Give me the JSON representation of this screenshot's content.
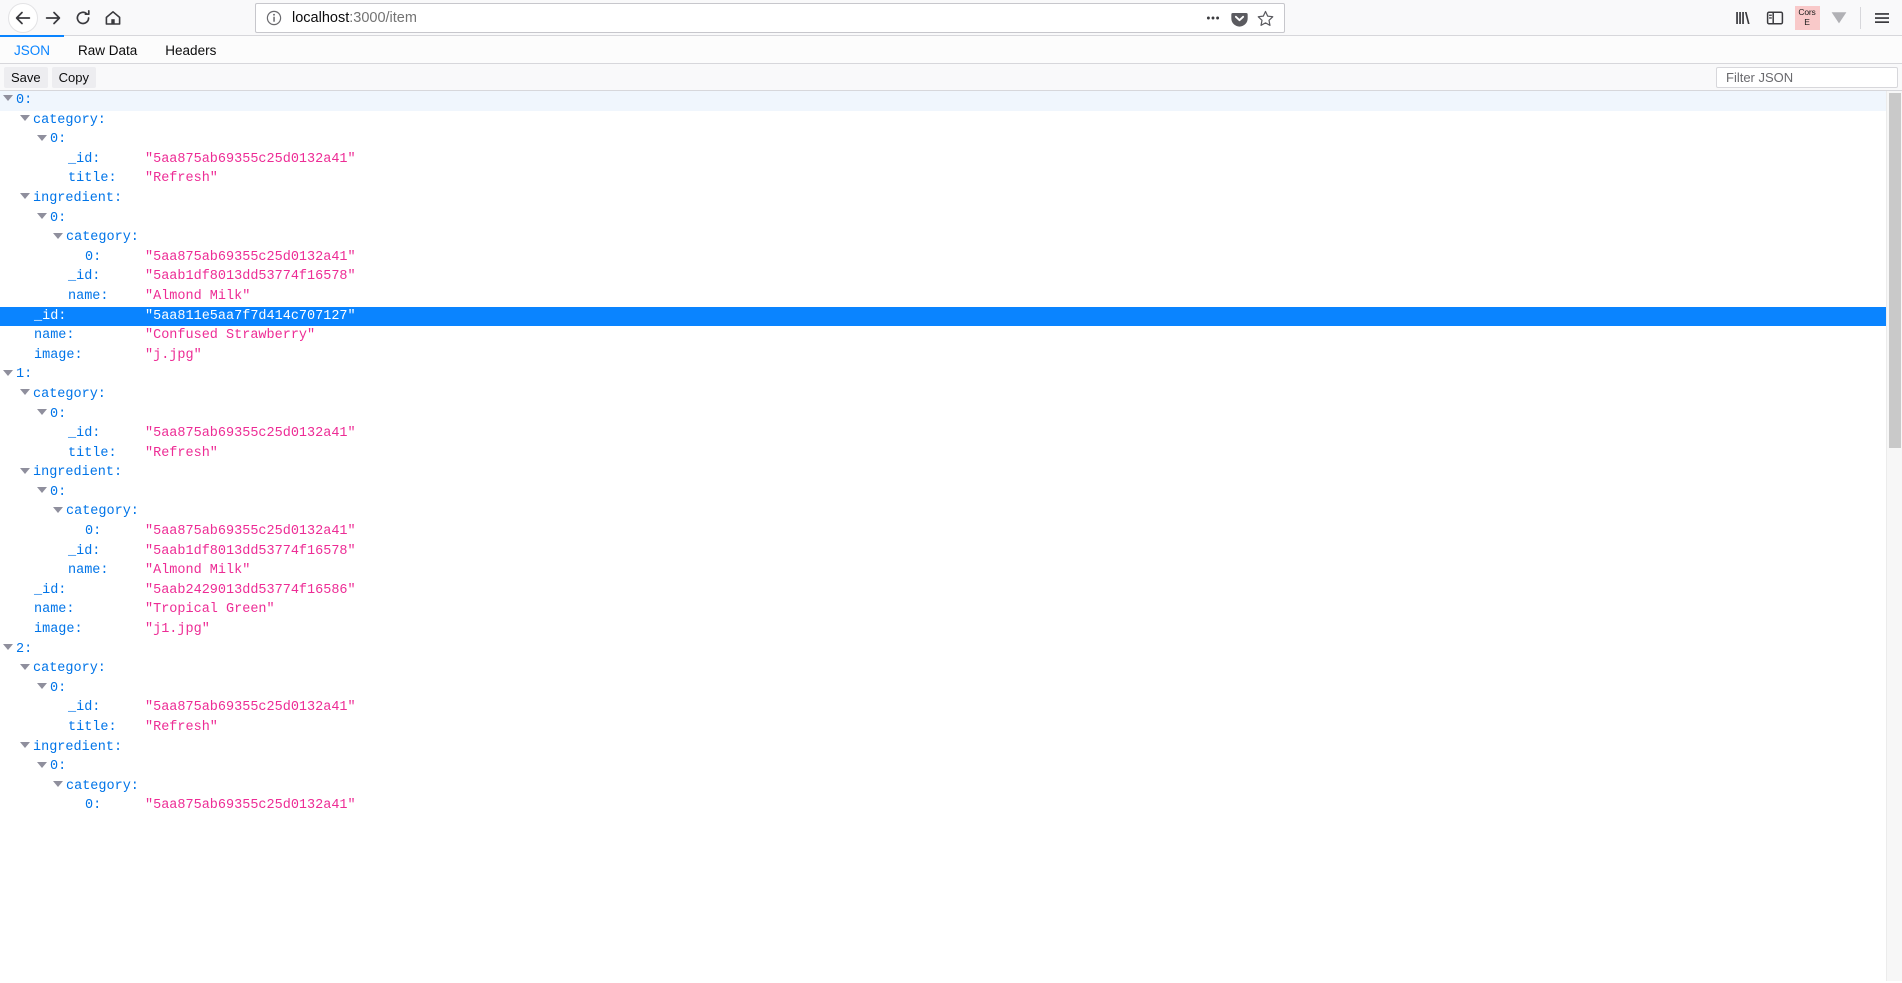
{
  "browser": {
    "nav": {
      "back": "back-arrow",
      "forward": "forward-arrow",
      "reload": "reload-arrow",
      "home": "home-house"
    },
    "urlbar": {
      "identity_icon": "info-circle-icon",
      "host": "localhost",
      "path": ":3000/item",
      "full_url": "localhost:3000/item",
      "page_actions_icon": "ellipsis-icon",
      "pocket_icon": "pocket-icon",
      "bookmark_icon": "star-icon"
    },
    "toolbar_right": {
      "library_icon": "library-icon",
      "sidebar_icon": "sidebar-icon",
      "extension_badge": "Cors E",
      "extension_badge_line1": "Cors",
      "extension_badge_line2": "E",
      "extension_badge_color": "#f9c9c9",
      "downloads_icon": "downloads-chevron-icon",
      "menu_icon": "hamburger-menu-icon"
    }
  },
  "jsonviewer": {
    "tabs": [
      {
        "label": "JSON",
        "active": true
      },
      {
        "label": "Raw Data",
        "active": false
      },
      {
        "label": "Headers",
        "active": false
      }
    ],
    "active_tab_color": "#0a84ff",
    "toolbar": {
      "save_label": "Save",
      "copy_label": "Copy",
      "filter_placeholder": "Filter JSON",
      "filter_value": "",
      "filter_icon": "funnel-icon"
    },
    "selection_color": "#0a84ff",
    "rows": [
      {
        "depth": 0,
        "twisty": true,
        "label": "0:",
        "value": "",
        "selected": false,
        "header": true
      },
      {
        "depth": 1,
        "twisty": true,
        "label": "category:",
        "value": "",
        "selected": false,
        "header": false
      },
      {
        "depth": 2,
        "twisty": true,
        "label": "0:",
        "value": "",
        "selected": false,
        "header": false
      },
      {
        "depth": 3,
        "twisty": false,
        "label": "_id:",
        "value": "\"5aa875ab69355c25d0132a41\"",
        "selected": false,
        "header": false
      },
      {
        "depth": 3,
        "twisty": false,
        "label": "title:",
        "value": "\"Refresh\"",
        "selected": false,
        "header": false
      },
      {
        "depth": 1,
        "twisty": true,
        "label": "ingredient:",
        "value": "",
        "selected": false,
        "header": false
      },
      {
        "depth": 2,
        "twisty": true,
        "label": "0:",
        "value": "",
        "selected": false,
        "header": false
      },
      {
        "depth": 3,
        "twisty": true,
        "label": "category:",
        "value": "",
        "selected": false,
        "header": false
      },
      {
        "depth": 4,
        "twisty": false,
        "label": "0:",
        "value": "\"5aa875ab69355c25d0132a41\"",
        "selected": false,
        "header": false
      },
      {
        "depth": 3,
        "twisty": false,
        "label": "_id:",
        "value": "\"5aab1df8013dd53774f16578\"",
        "selected": false,
        "header": false
      },
      {
        "depth": 3,
        "twisty": false,
        "label": "name:",
        "value": "\"Almond Milk\"",
        "selected": false,
        "header": false
      },
      {
        "depth": 1,
        "twisty": false,
        "label": "_id:",
        "value": "\"5aa811e5aa7f7d414c707127\"",
        "selected": true,
        "header": false
      },
      {
        "depth": 1,
        "twisty": false,
        "label": "name:",
        "value": "\"Confused Strawberry\"",
        "selected": false,
        "header": false
      },
      {
        "depth": 1,
        "twisty": false,
        "label": "image:",
        "value": "\"j.jpg\"",
        "selected": false,
        "header": false
      },
      {
        "depth": 0,
        "twisty": true,
        "label": "1:",
        "value": "",
        "selected": false,
        "header": false
      },
      {
        "depth": 1,
        "twisty": true,
        "label": "category:",
        "value": "",
        "selected": false,
        "header": false
      },
      {
        "depth": 2,
        "twisty": true,
        "label": "0:",
        "value": "",
        "selected": false,
        "header": false
      },
      {
        "depth": 3,
        "twisty": false,
        "label": "_id:",
        "value": "\"5aa875ab69355c25d0132a41\"",
        "selected": false,
        "header": false
      },
      {
        "depth": 3,
        "twisty": false,
        "label": "title:",
        "value": "\"Refresh\"",
        "selected": false,
        "header": false
      },
      {
        "depth": 1,
        "twisty": true,
        "label": "ingredient:",
        "value": "",
        "selected": false,
        "header": false
      },
      {
        "depth": 2,
        "twisty": true,
        "label": "0:",
        "value": "",
        "selected": false,
        "header": false
      },
      {
        "depth": 3,
        "twisty": true,
        "label": "category:",
        "value": "",
        "selected": false,
        "header": false
      },
      {
        "depth": 4,
        "twisty": false,
        "label": "0:",
        "value": "\"5aa875ab69355c25d0132a41\"",
        "selected": false,
        "header": false
      },
      {
        "depth": 3,
        "twisty": false,
        "label": "_id:",
        "value": "\"5aab1df8013dd53774f16578\"",
        "selected": false,
        "header": false
      },
      {
        "depth": 3,
        "twisty": false,
        "label": "name:",
        "value": "\"Almond Milk\"",
        "selected": false,
        "header": false
      },
      {
        "depth": 1,
        "twisty": false,
        "label": "_id:",
        "value": "\"5aab2429013dd53774f16586\"",
        "selected": false,
        "header": false
      },
      {
        "depth": 1,
        "twisty": false,
        "label": "name:",
        "value": "\"Tropical Green\"",
        "selected": false,
        "header": false
      },
      {
        "depth": 1,
        "twisty": false,
        "label": "image:",
        "value": "\"j1.jpg\"",
        "selected": false,
        "header": false
      },
      {
        "depth": 0,
        "twisty": true,
        "label": "2:",
        "value": "",
        "selected": false,
        "header": false
      },
      {
        "depth": 1,
        "twisty": true,
        "label": "category:",
        "value": "",
        "selected": false,
        "header": false
      },
      {
        "depth": 2,
        "twisty": true,
        "label": "0:",
        "value": "",
        "selected": false,
        "header": false
      },
      {
        "depth": 3,
        "twisty": false,
        "label": "_id:",
        "value": "\"5aa875ab69355c25d0132a41\"",
        "selected": false,
        "header": false
      },
      {
        "depth": 3,
        "twisty": false,
        "label": "title:",
        "value": "\"Refresh\"",
        "selected": false,
        "header": false
      },
      {
        "depth": 1,
        "twisty": true,
        "label": "ingredient:",
        "value": "",
        "selected": false,
        "header": false
      },
      {
        "depth": 2,
        "twisty": true,
        "label": "0:",
        "value": "",
        "selected": false,
        "header": false
      },
      {
        "depth": 3,
        "twisty": true,
        "label": "category:",
        "value": "",
        "selected": false,
        "header": false
      },
      {
        "depth": 4,
        "twisty": false,
        "label": "0:",
        "value": "\"5aa875ab69355c25d0132a41\"",
        "selected": false,
        "header": false
      }
    ],
    "scrollbar": {
      "thumb_color": "#c9c9c9",
      "track_color": "#f7f7f7"
    }
  }
}
